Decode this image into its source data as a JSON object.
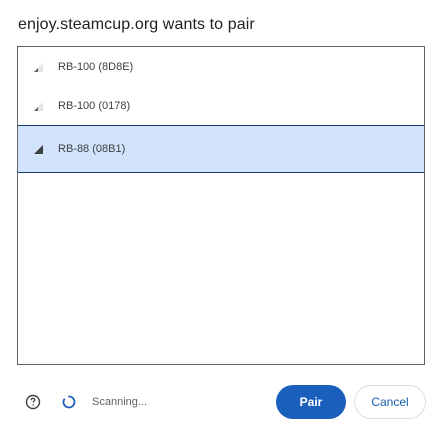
{
  "dialog": {
    "title": "enjoy.steamcup.org wants to pair"
  },
  "devices": [
    {
      "label": "RB-100 (8D8E)",
      "signal_icon": "signal-strength-low-icon",
      "selected": false
    },
    {
      "label": "RB-100 (0178)",
      "signal_icon": "signal-strength-low-icon",
      "selected": false
    },
    {
      "label": "RB-88 (08B1)",
      "signal_icon": "signal-strength-high-icon",
      "selected": true
    }
  ],
  "footer": {
    "help_icon": "help-circle-icon",
    "spinner_icon": "loading-spinner-icon",
    "status_text": "Scanning...",
    "pair_label": "Pair",
    "cancel_label": "Cancel"
  },
  "colors": {
    "accent": "#1b5fbd",
    "selected_row": "#d2e3fc"
  }
}
